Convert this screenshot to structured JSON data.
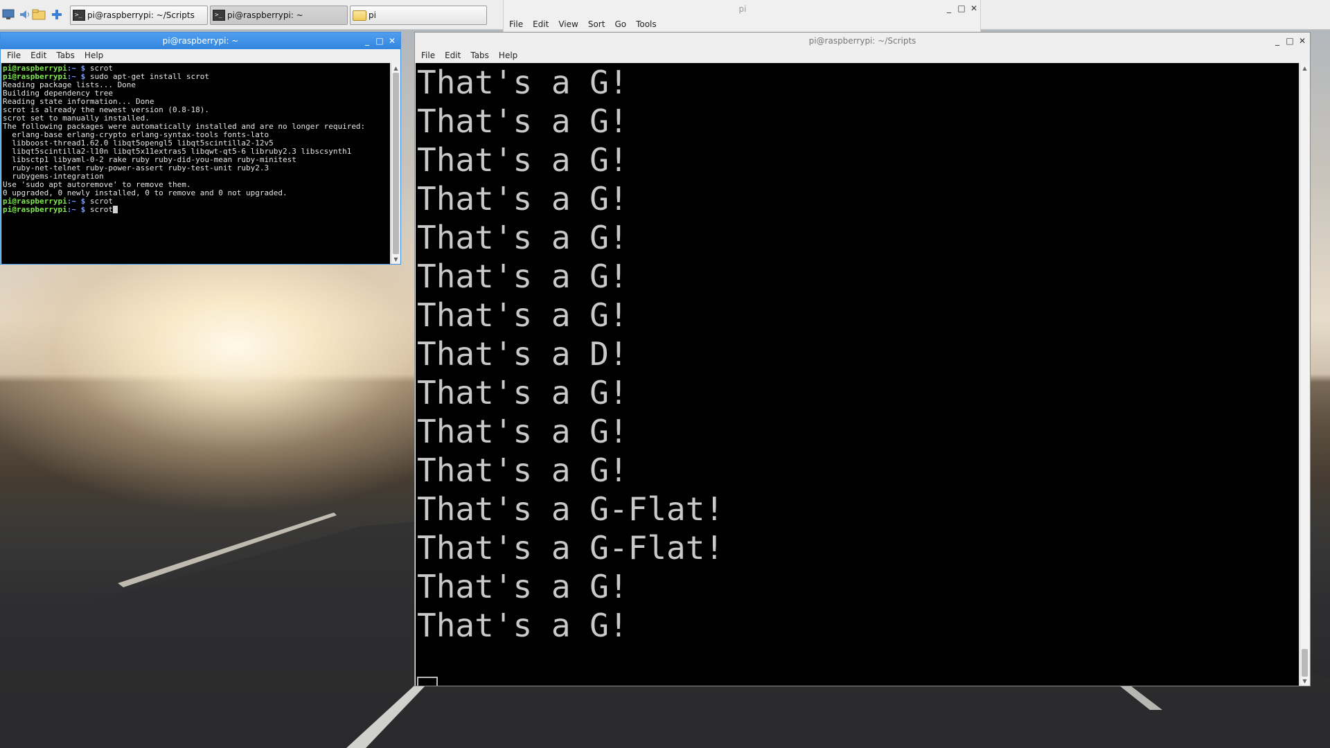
{
  "panel": {
    "launchers": [
      {
        "icon": "computer-icon"
      },
      {
        "icon": "speaker-icon"
      },
      {
        "icon": "folder-icon"
      },
      {
        "icon": "plus-icon"
      }
    ],
    "tasks": [
      {
        "label": "pi@raspberrypi: ~/Scripts",
        "type": "terminal",
        "active": false
      },
      {
        "label": "pi@raspberrypi: ~",
        "type": "terminal",
        "active": true
      },
      {
        "label": "pi",
        "type": "folder",
        "active": false
      }
    ]
  },
  "file_manager": {
    "title": "pi",
    "menu": [
      "File",
      "Edit",
      "View",
      "Sort",
      "Go",
      "Tools"
    ]
  },
  "small_terminal": {
    "title": "pi@raspberrypi: ~",
    "menu": [
      "File",
      "Edit",
      "Tabs",
      "Help"
    ],
    "prompt_user": "pi@raspberrypi",
    "prompt_path": ":~ $",
    "lines": [
      {
        "type": "cmd",
        "text": " scrot"
      },
      {
        "type": "cmd",
        "text": " sudo apt-get install scrot"
      },
      {
        "type": "out",
        "text": "Reading package lists... Done"
      },
      {
        "type": "out",
        "text": "Building dependency tree"
      },
      {
        "type": "out",
        "text": "Reading state information... Done"
      },
      {
        "type": "out",
        "text": "scrot is already the newest version (0.8-18)."
      },
      {
        "type": "out",
        "text": "scrot set to manually installed."
      },
      {
        "type": "out",
        "text": "The following packages were automatically installed and are no longer required:"
      },
      {
        "type": "out",
        "text": "  erlang-base erlang-crypto erlang-syntax-tools fonts-lato"
      },
      {
        "type": "out",
        "text": "  libboost-thread1.62.0 libqt5opengl5 libqt5scintilla2-12v5"
      },
      {
        "type": "out",
        "text": "  libqt5scintilla2-l10n libqt5x11extras5 libqwt-qt5-6 libruby2.3 libscsynth1"
      },
      {
        "type": "out",
        "text": "  libsctp1 libyaml-0-2 rake ruby ruby-did-you-mean ruby-minitest"
      },
      {
        "type": "out",
        "text": "  ruby-net-telnet ruby-power-assert ruby-test-unit ruby2.3"
      },
      {
        "type": "out",
        "text": "  rubygems-integration"
      },
      {
        "type": "out",
        "text": "Use 'sudo apt autoremove' to remove them."
      },
      {
        "type": "out",
        "text": "0 upgraded, 0 newly installed, 0 to remove and 0 not upgraded."
      },
      {
        "type": "cmd",
        "text": " scrot"
      },
      {
        "type": "cmd",
        "text": " scrot",
        "cursor": true
      }
    ]
  },
  "big_terminal": {
    "title": "pi@raspberrypi: ~/Scripts",
    "menu": [
      "File",
      "Edit",
      "Tabs",
      "Help"
    ],
    "lines": [
      "That's a G!",
      "That's a G!",
      "That's a G!",
      "That's a G!",
      "That's a G!",
      "That's a G!",
      "That's a G!",
      "That's a D!",
      "That's a G!",
      "That's a G!",
      "That's a G!",
      "That's a G-Flat!",
      "That's a G-Flat!",
      "That's a G!",
      "That's a G!"
    ]
  },
  "window_controls": {
    "minimize": "_",
    "maximize": "□",
    "close": "✕"
  }
}
